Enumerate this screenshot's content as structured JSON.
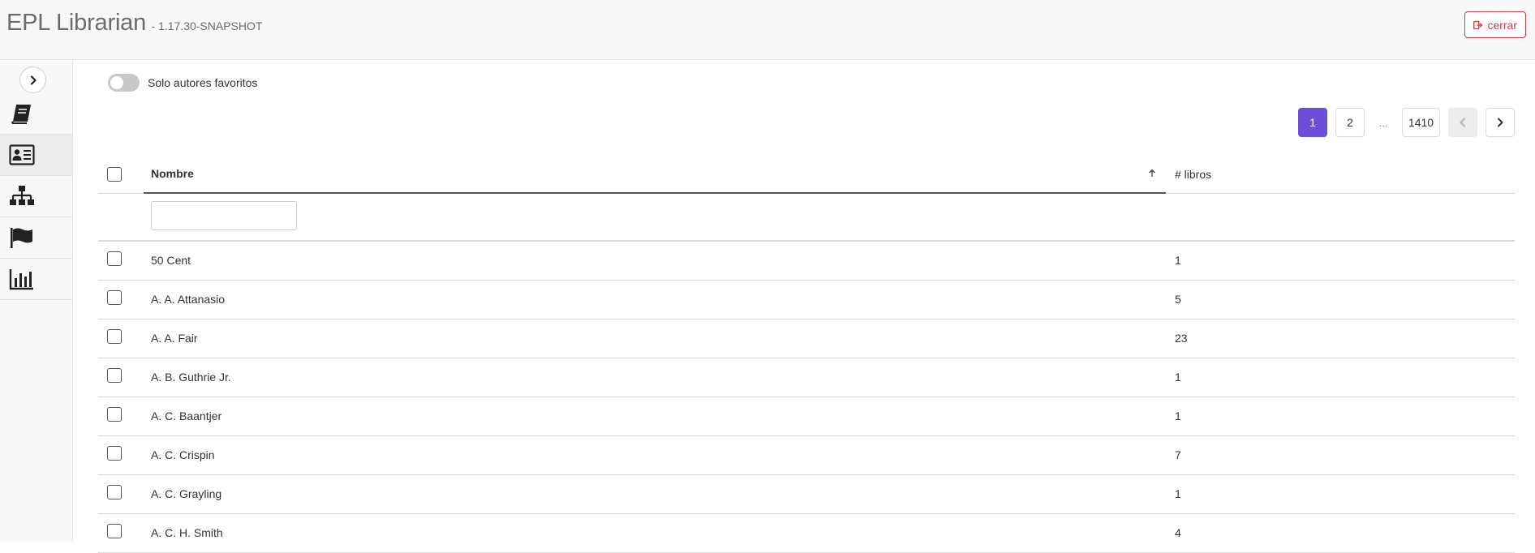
{
  "header": {
    "title": "EPL Librarian",
    "version": "- 1.17.30-SNAPSHOT",
    "close_label": "cerrar",
    "close_icon": "sign-out-icon",
    "close_color": "#dc3545"
  },
  "sidebar": {
    "toggle_icon": "chevron-right-icon",
    "items": [
      {
        "name": "books",
        "icon": "book-icon",
        "active": false
      },
      {
        "name": "authors",
        "icon": "address-card-icon",
        "active": true
      },
      {
        "name": "hierarchy",
        "icon": "sitemap-icon",
        "active": false
      },
      {
        "name": "languages",
        "icon": "flag-icon",
        "active": false
      },
      {
        "name": "stats",
        "icon": "bar-chart-icon",
        "active": false
      }
    ]
  },
  "filters": {
    "favorites_label": "Solo autores favoritos",
    "favorites_on": false,
    "name_filter_value": ""
  },
  "pagination": {
    "pages": [
      "1",
      "2",
      "...",
      "1410"
    ],
    "current": "1",
    "accent_color": "#6c4fd6"
  },
  "table": {
    "columns": [
      "Nombre",
      "# libros"
    ],
    "sort_column": "Nombre",
    "sort_direction": "asc",
    "rows": [
      {
        "name": "50 Cent",
        "count": "1"
      },
      {
        "name": "A. A. Attanasio",
        "count": "5"
      },
      {
        "name": "A. A. Fair",
        "count": "23"
      },
      {
        "name": "A. B. Guthrie Jr.",
        "count": "1"
      },
      {
        "name": "A. C. Baantjer",
        "count": "1"
      },
      {
        "name": "A. C. Crispin",
        "count": "7"
      },
      {
        "name": "A. C. Grayling",
        "count": "1"
      },
      {
        "name": "A. C. H. Smith",
        "count": "4"
      }
    ]
  }
}
